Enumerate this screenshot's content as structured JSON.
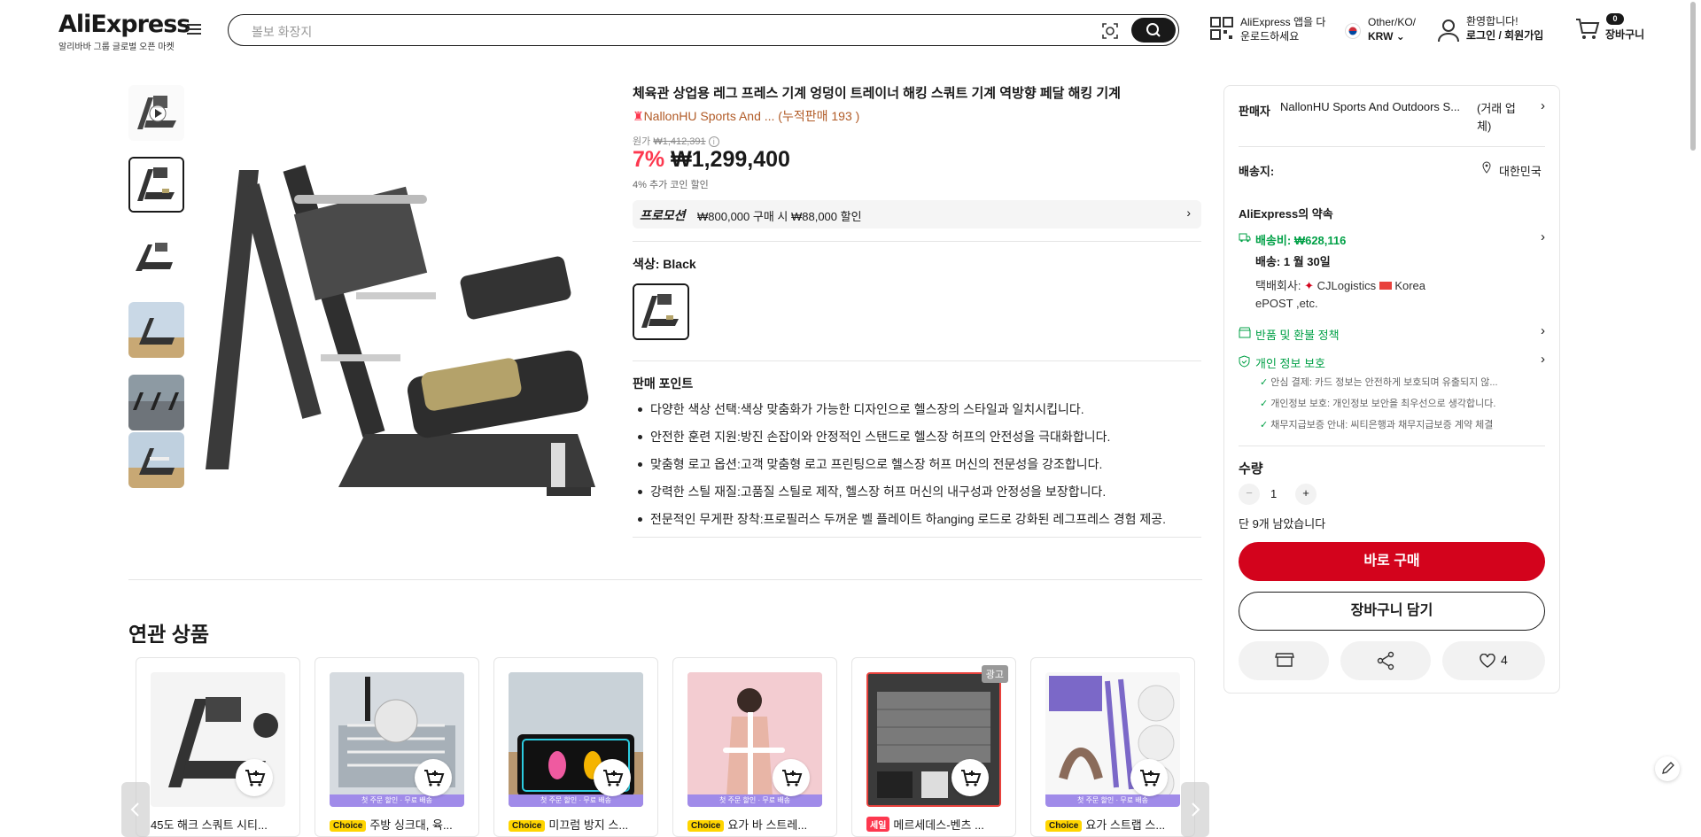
{
  "header": {
    "logo": "AliExpress",
    "logo_sub": "알리바바 그룹 글로벌 오픈 마켓",
    "search_placeholder": "볼보 화장지",
    "app_line1": "AliExpress 앱을 다",
    "app_line2": "운로드하세요",
    "region_line1": "Other/KO/",
    "region_line2": "KRW",
    "greeting": "환영합니다!",
    "login": "로그인 / 회원가입",
    "cart_count": "0",
    "cart_label": "장바구니"
  },
  "product": {
    "title": "체육관 상업용 레그 프레스 기계 엉덩이 트레이너 해킹 스쿼트 기계 역방향 페달 해킹 기계",
    "store": "NallonHU Sports And ... (누적판매 193 )",
    "orig_label": "원가",
    "orig_price": "₩1,412,391",
    "discount": "7%",
    "price": "₩1,299,400",
    "coin_discount": "4% 추가 코인 할인",
    "promo_label": "프로모션",
    "promo_text": "₩800,000 구매 시 ₩88,000 할인",
    "color_label": "색상: Black",
    "selling_points_title": "판매 포인트",
    "selling_points": [
      "다양한 색상 선택:색상 맞춤화가 가능한 디자인으로 헬스장의 스타일과 일치시킵니다.",
      "안전한 훈련 지원:방진 손잡이와 안정적인 스탠드로 헬스장 허프의 안전성을 극대화합니다.",
      "맞춤형 로고 옵션:고객 맞춤형 로고 프린팅으로 헬스장 허프 머신의 전문성을 강조합니다.",
      "강력한 스틸 재질:고품질 스틸로 제작, 헬스장 허프 머신의 내구성과 안정성을 보장합니다.",
      "전문적인 무게판 장착:프로필러스 두꺼운 벨 플레이트 하anging 로드로 강화된 레그프레스 경험 제공."
    ]
  },
  "panel": {
    "seller_label": "판매자",
    "seller_name": "NallonHU Sports And Outdoors S...",
    "seller_type": "(거래 업체)",
    "ship_to_label": "배송지:",
    "ship_to": "대한민국",
    "promise_title": "AliExpress의 약속",
    "shipping_fee": "배송비: ₩628,116",
    "delivery": "배송: 1 월 30일",
    "carrier_label": "택배회사:",
    "carrier1": "CJLogistics",
    "carrier2": "Korea",
    "carrier3": "ePOST ,etc.",
    "refund": "반품 및 환불 정책",
    "privacy": "개인 정보 보호",
    "privacy_items": [
      "안심 결제: 카드 정보는 안전하게 보호되며 유출되지 않...",
      "개인정보 보호: 개인정보 보안을 최우선으로 생각합니다.",
      "채무지급보증 안내: 씨티은행과 채무지급보증 계약 체결"
    ],
    "qty_label": "수량",
    "qty": "1",
    "stock": "단 9개 남았습니다",
    "buy_now": "바로 구매",
    "add_cart": "장바구니 담기",
    "wish_count": "4"
  },
  "related": {
    "title": "연관 상품",
    "strip_text": "첫 주문 할인 · 무료 배송",
    "ad_label": "광고",
    "items": [
      {
        "tag": "",
        "name": "45도 해크 스쿼트 시티..."
      },
      {
        "tag": "Choice",
        "name": "주방 싱크대, 육..."
      },
      {
        "tag": "Choice",
        "name": "미끄럼 방지 스..."
      },
      {
        "tag": "Choice",
        "name": "요가 바 스트레..."
      },
      {
        "tag": "세일",
        "name": "메르세데스-벤츠 ..."
      },
      {
        "tag": "Choice",
        "name": "요가 스트랩 스..."
      }
    ]
  },
  "colors": {
    "accent": "#fd384f",
    "buy": "#d3031c",
    "green": "#00a046",
    "store": "#b15b27"
  }
}
